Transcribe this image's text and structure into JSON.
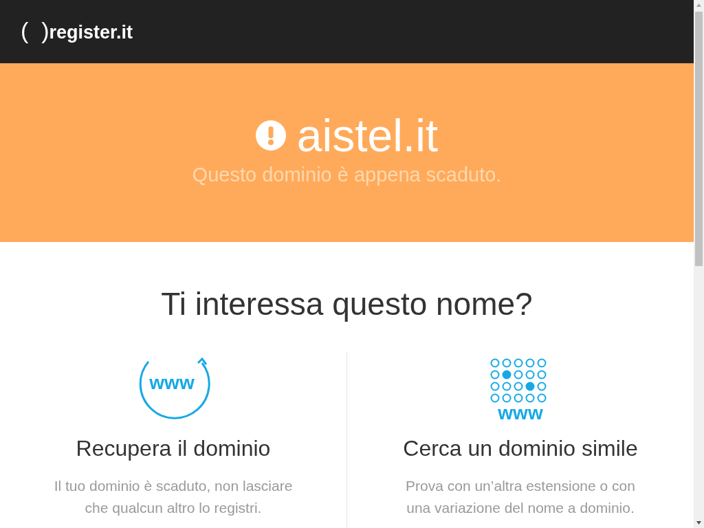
{
  "header": {
    "logo_mark": "(  )",
    "logo_text": "register.it"
  },
  "hero": {
    "title": "aistel.it",
    "subtitle": "Questo dominio è appena scaduto."
  },
  "section": {
    "heading": "Ti interessa questo nome?",
    "options": [
      {
        "kind": "renew",
        "icon_text": "www",
        "title": "Recupera il dominio",
        "text": "Il tuo dominio è scaduto, non lasciare che qualcun altro lo registri."
      },
      {
        "kind": "search",
        "icon_text": "www",
        "title": "Cerca un dominio simile",
        "text": "Prova con un’altra estensione o con una variazione del nome a dominio."
      }
    ]
  }
}
